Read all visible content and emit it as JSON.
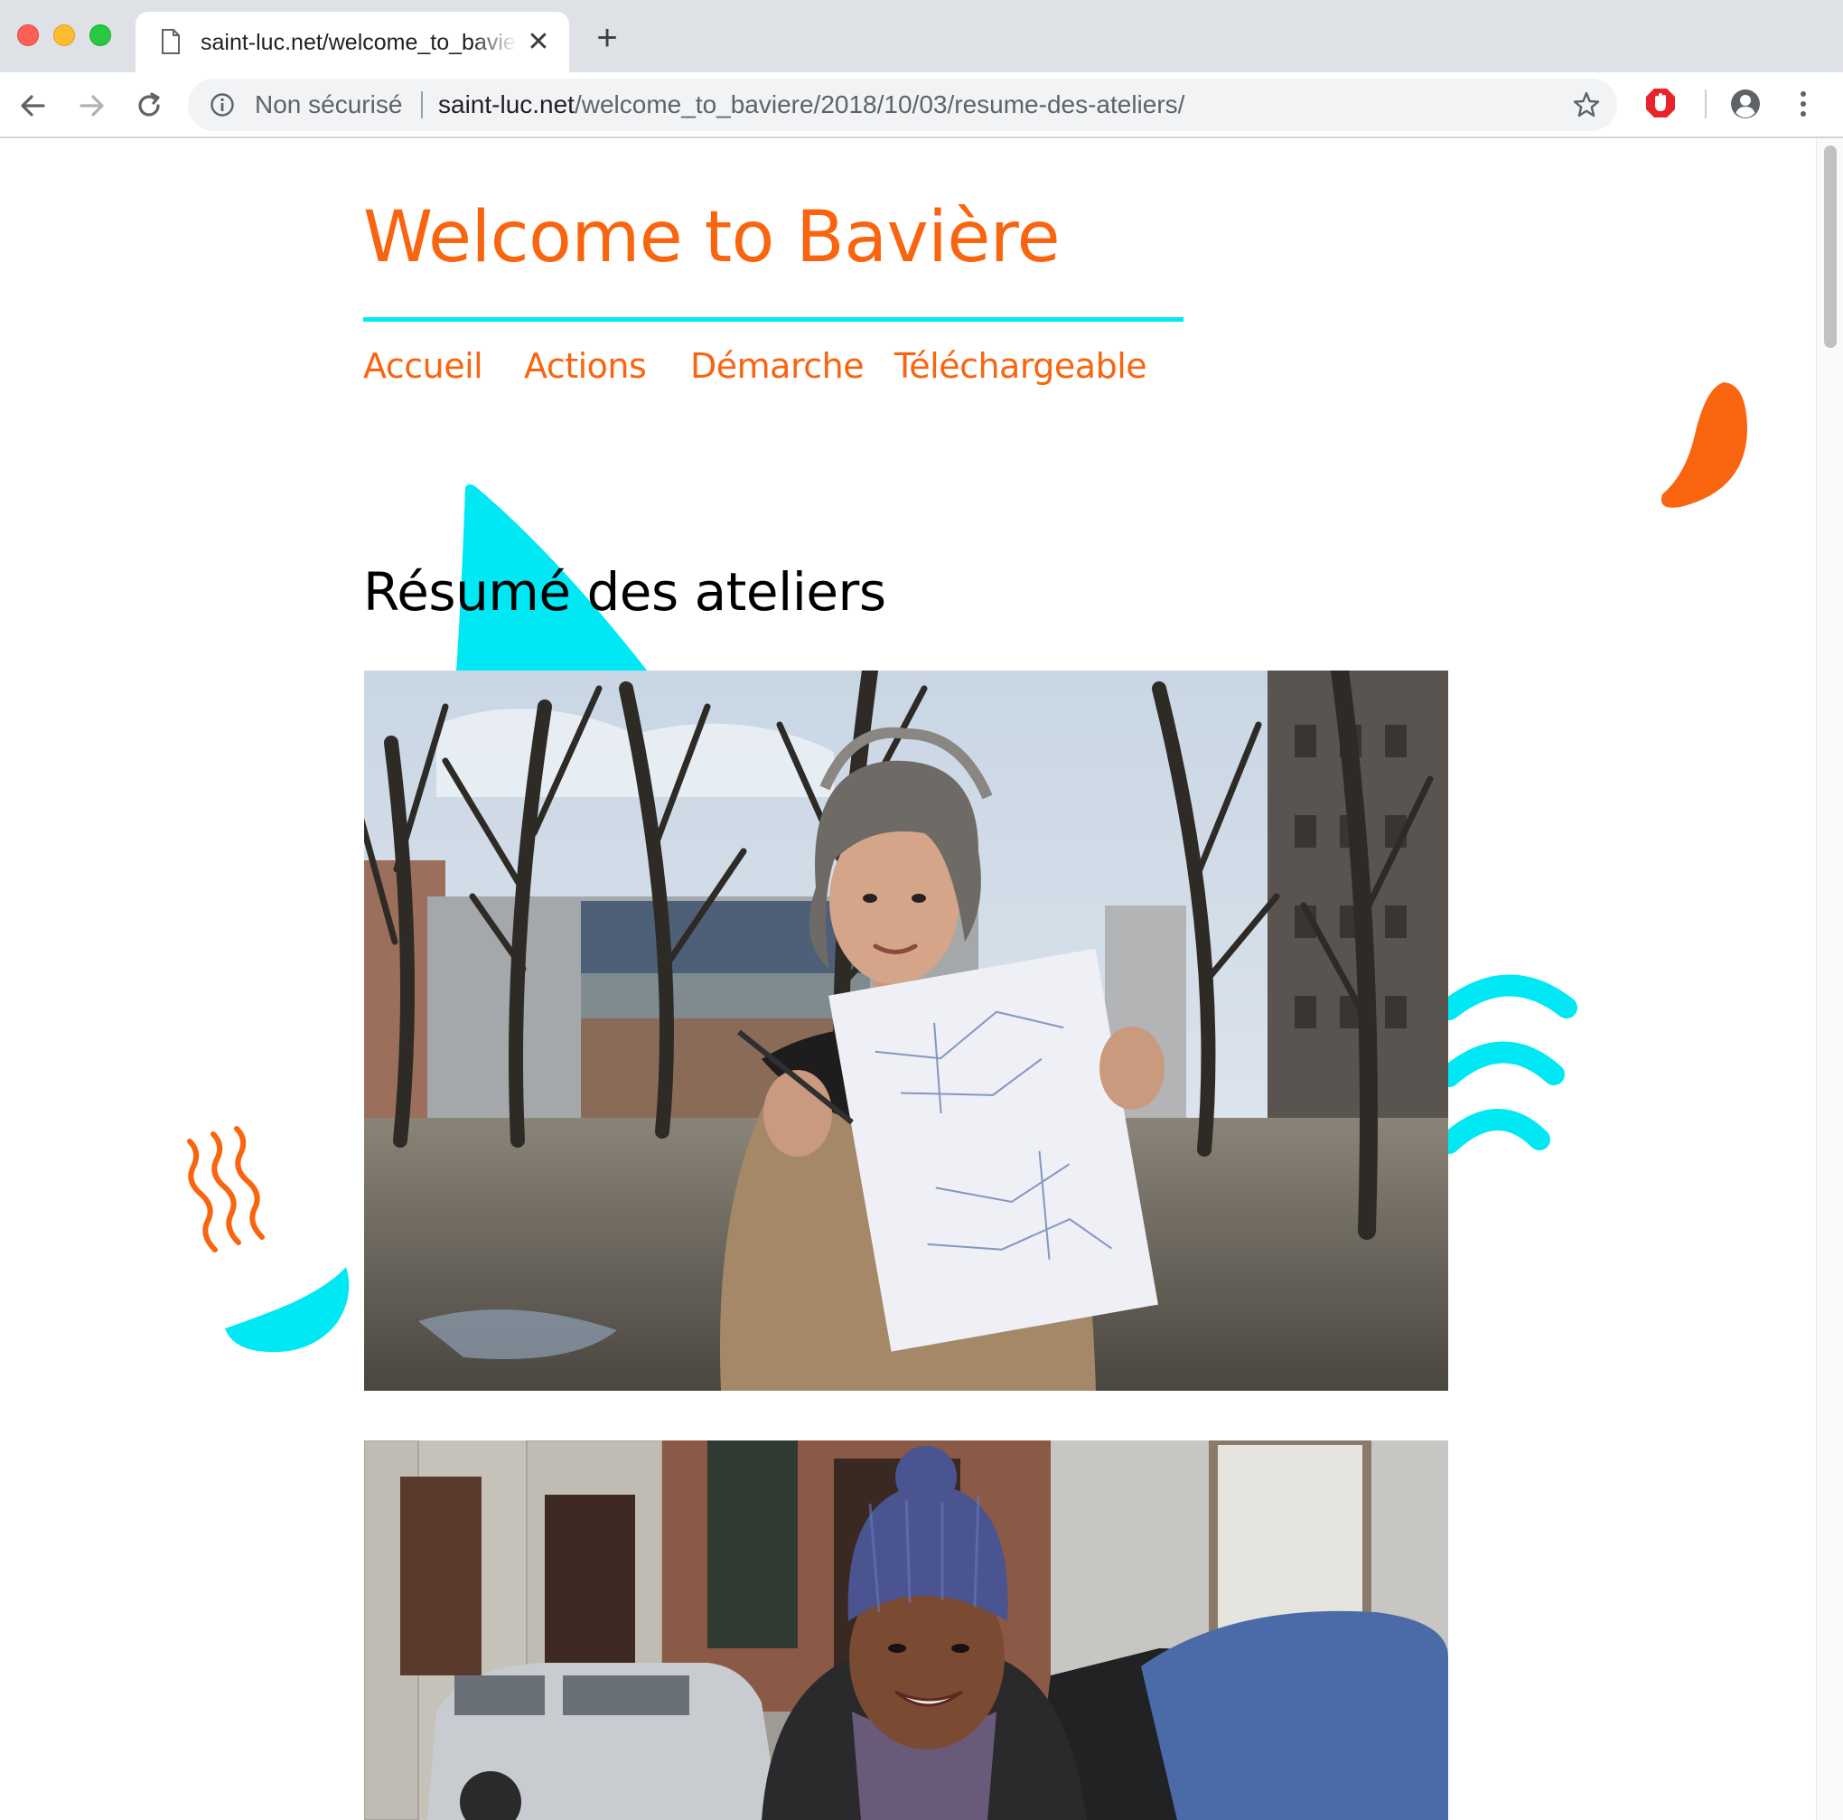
{
  "browser": {
    "tab_title": "saint-luc.net/welcome_to_baviere/2018/10/03/resume-des-ateliers/",
    "tab_close": "✕",
    "new_tab": "+",
    "security_label": "Non sécurisé",
    "url_host": "saint-luc.net",
    "url_path": "/welcome_to_baviere/2018/10/03/resume-des-ateliers/",
    "icons": [
      "back-icon",
      "forward-icon",
      "reload-icon",
      "info-icon",
      "star-icon",
      "adblock-extension-icon",
      "profile-icon",
      "menu-icon",
      "page-icon"
    ]
  },
  "site": {
    "title": "Welcome to Bavière",
    "nav": [
      "Accueil",
      "Actions",
      "Démarche",
      "Téléchargeable"
    ]
  },
  "post": {
    "title": "Résumé des ateliers"
  },
  "colors": {
    "accent_orange": "#f9640f",
    "accent_cyan": "#00e8f4",
    "text": "#000000",
    "chrome_bg": "#dee1e6"
  }
}
